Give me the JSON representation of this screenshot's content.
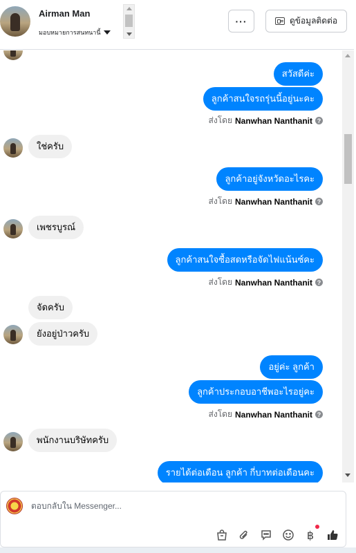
{
  "header": {
    "contact_name": "Airman Man",
    "assign_label": "มอบหมายการสนทนานี้",
    "more_label": "···",
    "contact_info_label": "ดูข้อมูลติดต่อ"
  },
  "messages": [
    {
      "side": "out",
      "text": "สวัสดีค่ะ"
    },
    {
      "side": "out",
      "text": "ลูกค้าสนใจรถรุ่นนี้อยู่นะคะ"
    },
    {
      "side": "meta",
      "prefix": "ส่งโดย",
      "sender": "Nanwhan Nanthanit"
    },
    {
      "side": "in",
      "text": "ใช่ครับ"
    },
    {
      "side": "out",
      "text": "ลูกค้าอยู่จังหวัดอะไรคะ"
    },
    {
      "side": "meta",
      "prefix": "ส่งโดย",
      "sender": "Nanwhan Nanthanit"
    },
    {
      "side": "in",
      "text": "เพชรบูรณ์"
    },
    {
      "side": "out",
      "text": "ลูกค้าสนใจซื้อสดหรือจัดไฟแน้นซ์คะ"
    },
    {
      "side": "meta",
      "prefix": "ส่งโดย",
      "sender": "Nanwhan Nanthanit"
    },
    {
      "side": "in",
      "text": "จัดครับ"
    },
    {
      "side": "in",
      "text": "ยังอยู่ป่าวครับ"
    },
    {
      "side": "out",
      "text": "อยู่ค่ะ ลูกค้า"
    },
    {
      "side": "out",
      "text": "ลูกค้าประกอบอาชีพอะไรอยู่คะ"
    },
    {
      "side": "meta",
      "prefix": "ส่งโดย",
      "sender": "Nanwhan Nanthanit"
    },
    {
      "side": "in",
      "text": "พนักงานบริษัทครับ"
    },
    {
      "side": "out",
      "text": "รายได้ต่อเดือน ลูกค้า กี่บาทต่อเดือนคะ"
    }
  ],
  "composer": {
    "placeholder": "ตอบกลับใน Messenger..."
  },
  "toolbar": {
    "icons": [
      "shopping-bag-icon",
      "attachment-icon",
      "saved-reply-icon",
      "emoji-icon",
      "payment-baht-icon",
      "like-icon"
    ],
    "baht_symbol": "฿"
  }
}
